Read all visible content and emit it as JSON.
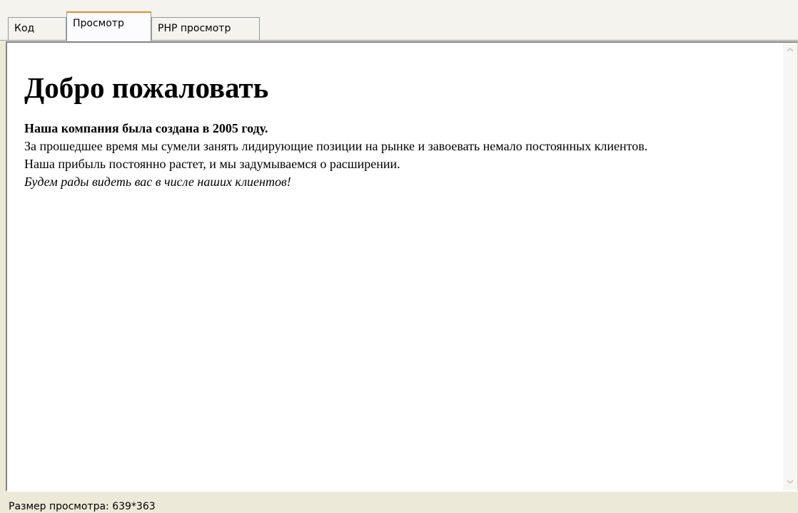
{
  "tabs": [
    {
      "label": "Код"
    },
    {
      "label": "Просмотр"
    },
    {
      "label": "PHP просмотр"
    }
  ],
  "active_tab": "Просмотр",
  "preview": {
    "heading": "Добро пожаловать",
    "bold_line": "Наша компания была создана в 2005 году.",
    "line1": "За прошедшее время мы сумели занять лидирующие позиции на рынке и завоевать немало постоянных клиентов.",
    "line2": "Наша прибыль постоянно растет, и мы задумываемся о расширении.",
    "italic_line": "Будем рады видеть вас в числе наших клиентов!"
  },
  "scrollbar": {
    "up_icon": "chevron-up-icon",
    "down_icon": "chevron-down-icon"
  },
  "status": {
    "text": "Размер просмотра: 639*363"
  },
  "colors": {
    "active_tab_accent": "#e68b2c",
    "window_background": "#ece9d8"
  }
}
